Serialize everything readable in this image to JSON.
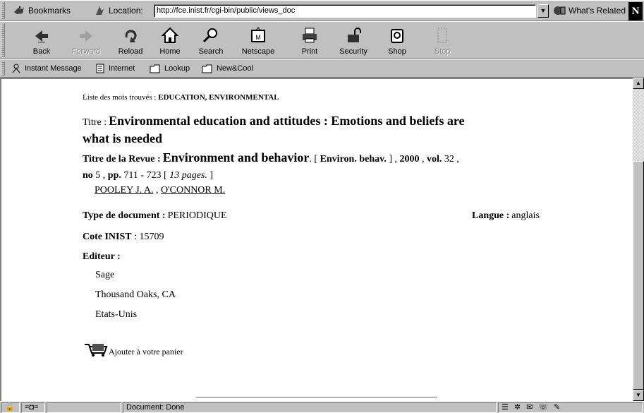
{
  "toolbar_location": {
    "bookmarks_label": "Bookmarks",
    "location_label": "Location:",
    "url": "http://fce.inist.fr/cgi-bin/public/views_doc",
    "whats_related_label": "What's Related",
    "netscape_logo": "N"
  },
  "nav_toolbar": {
    "buttons": [
      {
        "label": "Back",
        "icon": "back-arrow-icon",
        "enabled": true
      },
      {
        "label": "Forward",
        "icon": "forward-arrow-icon",
        "enabled": false
      },
      {
        "label": "Reload",
        "icon": "reload-icon",
        "enabled": true
      },
      {
        "label": "Home",
        "icon": "home-icon",
        "enabled": true
      },
      {
        "label": "Search",
        "icon": "search-icon",
        "enabled": true
      },
      {
        "label": "Netscape",
        "icon": "netscape-icon",
        "enabled": true
      },
      {
        "label": "Print",
        "icon": "print-icon",
        "enabled": true
      },
      {
        "label": "Security",
        "icon": "lock-icon",
        "enabled": true
      },
      {
        "label": "Shop",
        "icon": "shop-icon",
        "enabled": true
      },
      {
        "label": "Stop",
        "icon": "stop-icon",
        "enabled": false
      }
    ]
  },
  "personal_toolbar": {
    "items": [
      {
        "label": "Instant Message",
        "icon": "person-icon"
      },
      {
        "label": "Internet",
        "icon": "document-icon"
      },
      {
        "label": "Lookup",
        "icon": "folder-icon"
      },
      {
        "label": "New&Cool",
        "icon": "folder-icon"
      }
    ]
  },
  "document": {
    "found_words_label": "Liste des mots trouvés :",
    "found_words": "EDUCATION, ENVIRONMENTAL",
    "title_label": "Titre :",
    "title_line1": "Environmental education and attitudes : Emotions and beliefs are",
    "title_line2": "what is needed",
    "journal_label": "Titre de la Revue :",
    "journal_title": "Environment and behavior",
    "journal_abbrev": "Environ. behav.",
    "year": "2000",
    "vol_label": "vol.",
    "vol": "32",
    "no_label": "no",
    "no": "5",
    "pp_label": "pp.",
    "pages_range": "711 - 723",
    "pages_count": "13 pages.",
    "authors": [
      "POOLEY J. A.",
      "O'CONNOR M."
    ],
    "doc_type_label": "Type de document :",
    "doc_type": "PERIODIQUE",
    "language_label": "Langue :",
    "language": "anglais",
    "cote_label": "Cote INIST",
    "cote": "15709",
    "publisher_label": "Editeur :",
    "publisher_lines": [
      "Sage",
      "Thousand Oaks, CA",
      "Etats-Unis"
    ],
    "cart_label": "Ajouter à votre panier"
  },
  "status_bar": {
    "text": "Document: Done"
  }
}
